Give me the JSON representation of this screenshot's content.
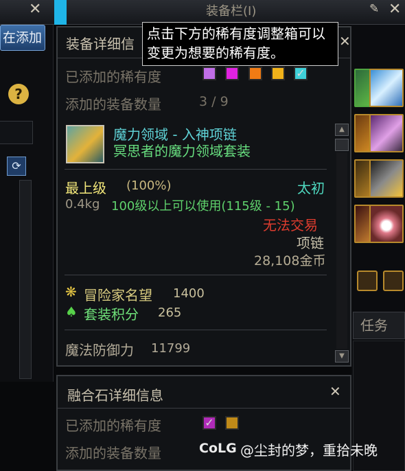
{
  "window": {
    "title": "装备栏(I)"
  },
  "left_panel": {
    "add_button": "在添加"
  },
  "right_panel": {
    "tab_quest": "任务"
  },
  "equip_panel": {
    "title": "装备详细信",
    "tooltip": "点击下方的稀有度调整箱可以变更为想要的稀有度。",
    "rarity_label": "已添加的稀有度",
    "rarity_colors": [
      "#c06ee6",
      "#e022e0",
      "#f07b14",
      "#f0b21a",
      "#3fd0d8"
    ],
    "count_label": "添加的装备数量",
    "count_value": "3 / 9",
    "item": {
      "name": "魔力领域 - 入神项链",
      "set_name": "冥思者的魔力领域套装",
      "grade": "最上级",
      "grade_pct": "(100%)",
      "type_name": "太初",
      "weight": "0.4kg",
      "level_req": "100级以上可以使用(115级 - 15)",
      "untradable": "无法交易",
      "slot_type": "项链",
      "price": "28,108金币",
      "fame_label": "冒险家名望",
      "fame_value": "1400",
      "set_points_label": "套装积分",
      "set_points_value": "265",
      "magic_def_label": "魔法防御力",
      "magic_def_value": "11799"
    }
  },
  "fusion_panel": {
    "title": "融合石详细信息",
    "rarity_label": "已添加的稀有度",
    "rarity_colors": [
      "#b02bb8",
      "#c08a18"
    ],
    "count_label": "添加的装备数量"
  },
  "watermark": {
    "logo": "CoLG",
    "text": "@尘封的梦，重拾未晚"
  }
}
